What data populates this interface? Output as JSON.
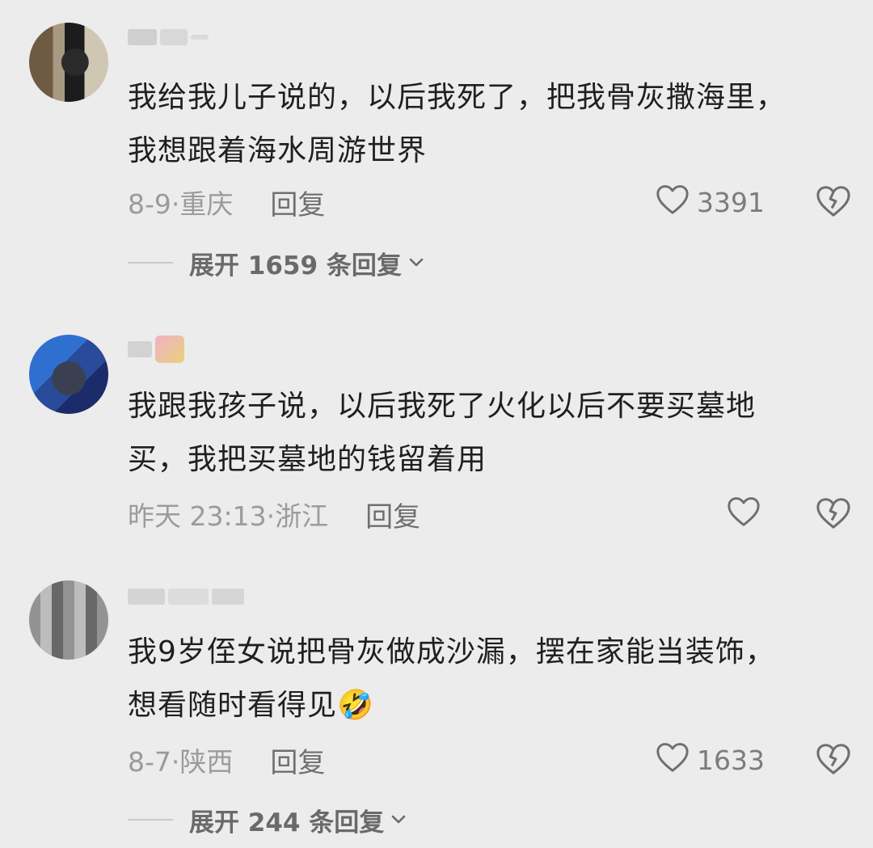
{
  "comments": [
    {
      "text_line1": "我给我儿子说的，以后我死了，把我骨灰撒海里，",
      "text_line2": "我想跟着海水周游世界",
      "meta": "8-9·重庆",
      "reply_label": "回复",
      "likes": "3391",
      "expand_label": "展开 1659 条回复"
    },
    {
      "text_line1": "我跟我孩子说，以后我死了火化以后不要买墓地",
      "text_line2": "买，我把买墓地的钱留着用",
      "meta": "昨天 23:13·浙江",
      "reply_label": "回复",
      "likes": ""
    },
    {
      "text_line1": "我9岁侄女说把骨灰做成沙漏，摆在家能当装饰，",
      "text_line2": "想看随时看得见",
      "emoji": "🤣",
      "meta": "8-7·陕西",
      "reply_label": "回复",
      "likes": "1633",
      "expand_label": "展开 244 条回复"
    }
  ],
  "icons": {
    "like": "heart-outline-icon",
    "dislike": "broken-heart-icon",
    "expand": "chevron-down-icon"
  },
  "colors": {
    "background": "#ececec",
    "text": "#1f1f1f",
    "meta": "#9b9b9b"
  }
}
